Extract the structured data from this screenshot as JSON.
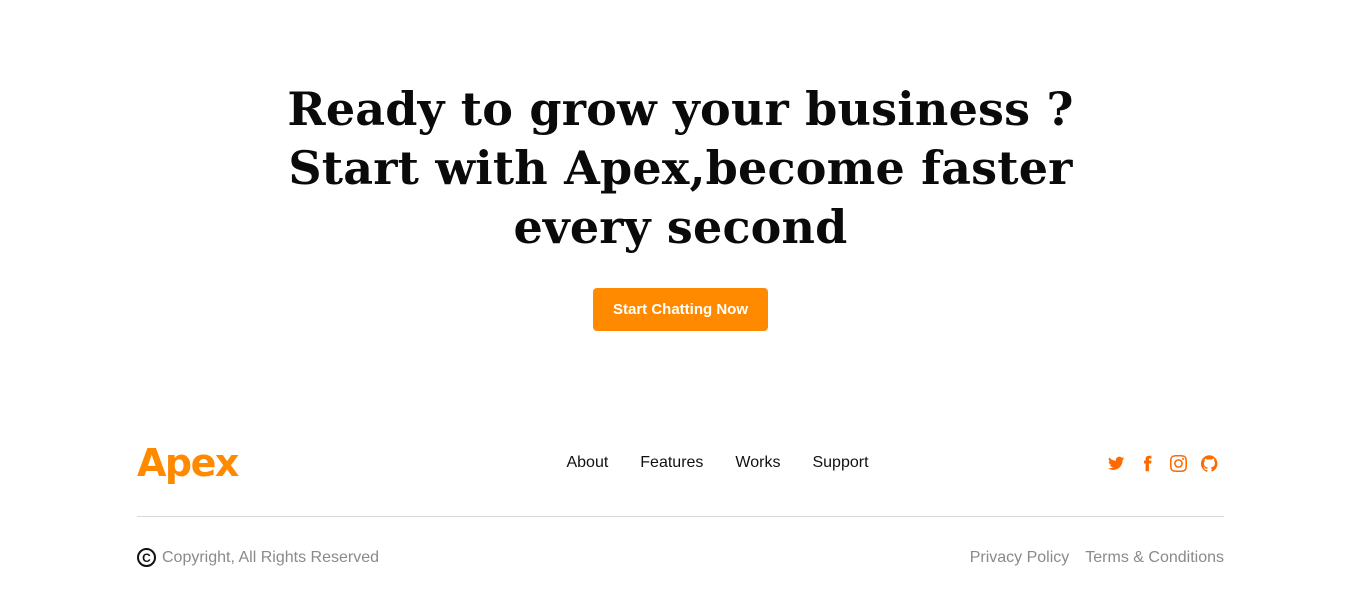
{
  "hero": {
    "title_lines": [
      "Ready to grow your business ?",
      "Start with Apex,become faster",
      "every second"
    ],
    "cta_label": "Start Chatting Now"
  },
  "footer": {
    "brand": "Apex",
    "nav": [
      "About",
      "Features",
      "Works",
      "Support"
    ],
    "socials": [
      "twitter-icon",
      "facebook-icon",
      "instagram-icon",
      "github-icon"
    ],
    "copyright_symbol": "C",
    "copyright": "Copyright, All Rights Reserved",
    "legal_links": [
      "Privacy Policy",
      "Terms & Conditions"
    ]
  },
  "colors": {
    "accent": "#ff8a00",
    "social_icon": "#ff6a00",
    "muted_text": "#8a8a8a",
    "divider": "#d9d9d9"
  }
}
